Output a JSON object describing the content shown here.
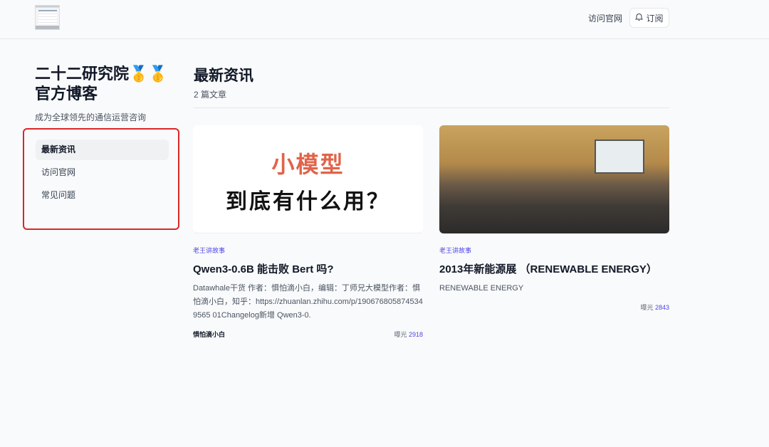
{
  "header": {
    "nav_link": "访问官网",
    "subscribe": "订阅"
  },
  "sidebar": {
    "title": "二十二研究院🥇🥇官方博客",
    "description": "成为全球领先的通信运营咨询",
    "items": [
      {
        "label": "最新资讯"
      },
      {
        "label": "访问官网"
      },
      {
        "label": "常见问题"
      }
    ]
  },
  "main": {
    "title": "最新资讯",
    "count": "2 篇文章",
    "articles": [
      {
        "thumb_line1": "小模型",
        "thumb_line2": "到底有什么用？",
        "category": "老王讲故事",
        "title": "Qwen3-0.6B 能击败 Bert 吗?",
        "excerpt": "Datawhale干货 作者：惧怕滴小白，编辑：丁师兄大模型作者：惧怕滴小白，知乎：https://zhuanlan.zhihu.com/p/1906768058745349565 01Changelog新增 Qwen3-0.",
        "author": "惧怕滴小白",
        "views_label": "曝光",
        "views": "2918"
      },
      {
        "category": "老王讲故事",
        "title": "2013年新能源展 （RENEWABLE ENERGY）",
        "excerpt": "RENEWABLE ENERGY",
        "views_label": "曝光",
        "views": "2843"
      }
    ]
  }
}
